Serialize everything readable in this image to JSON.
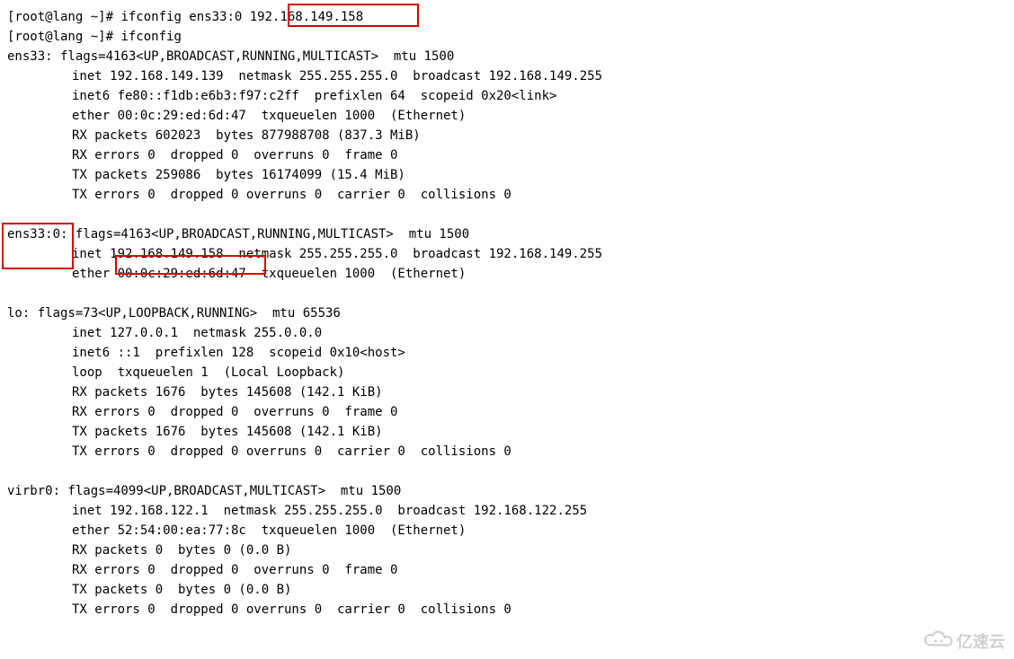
{
  "prompt": "[root@lang ~]# ",
  "cmd1": "ifconfig ens33:0 192.168.149.158",
  "cmd2": "ifconfig",
  "ens33": {
    "header": "ens33: flags=4163<UP,BROADCAST,RUNNING,MULTICAST>  mtu 1500",
    "l1": "inet 192.168.149.139  netmask 255.255.255.0  broadcast 192.168.149.255",
    "l2": "inet6 fe80::f1db:e6b3:f97:c2ff  prefixlen 64  scopeid 0x20<link>",
    "l3": "ether 00:0c:29:ed:6d:47  txqueuelen 1000  (Ethernet)",
    "l4": "RX packets 602023  bytes 877988708 (837.3 MiB)",
    "l5": "RX errors 0  dropped 0  overruns 0  frame 0",
    "l6": "TX packets 259086  bytes 16174099 (15.4 MiB)",
    "l7": "TX errors 0  dropped 0 overruns 0  carrier 0  collisions 0"
  },
  "ens33_0": {
    "header": "ens33:0: flags=4163<UP,BROADCAST,RUNNING,MULTICAST>  mtu 1500",
    "l1": "inet 192.168.149.158  netmask 255.255.255.0  broadcast 192.168.149.255",
    "l2": "ether 00:0c:29:ed:6d:47  txqueuelen 1000  (Ethernet)"
  },
  "lo": {
    "header": "lo: flags=73<UP,LOOPBACK,RUNNING>  mtu 65536",
    "l1": "inet 127.0.0.1  netmask 255.0.0.0",
    "l2": "inet6 ::1  prefixlen 128  scopeid 0x10<host>",
    "l3": "loop  txqueuelen 1  (Local Loopback)",
    "l4": "RX packets 1676  bytes 145608 (142.1 KiB)",
    "l5": "RX errors 0  dropped 0  overruns 0  frame 0",
    "l6": "TX packets 1676  bytes 145608 (142.1 KiB)",
    "l7": "TX errors 0  dropped 0 overruns 0  carrier 0  collisions 0"
  },
  "virbr0": {
    "header": "virbr0: flags=4099<UP,BROADCAST,MULTICAST>  mtu 1500",
    "l1": "inet 192.168.122.1  netmask 255.255.255.0  broadcast 192.168.122.255",
    "l2": "ether 52:54:00:ea:77:8c  txqueuelen 1000  (Ethernet)",
    "l3": "RX packets 0  bytes 0 (0.0 B)",
    "l4": "RX errors 0  dropped 0  overruns 0  frame 0",
    "l5": "TX packets 0  bytes 0 (0.0 B)",
    "l6": "TX errors 0  dropped 0 overruns 0  carrier 0  collisions 0"
  },
  "highlights": {
    "cmd_ip": "192.168.149.158",
    "iface_label": "ens33:0:",
    "inet_ip": "192.168.149.158"
  },
  "watermark_text": "亿速云"
}
